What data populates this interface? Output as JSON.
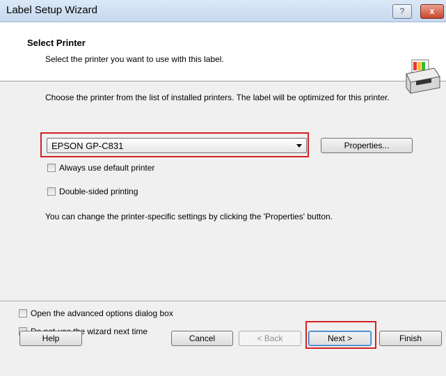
{
  "window": {
    "title": "Label Setup Wizard",
    "help_glyph": "?",
    "close_glyph": "x"
  },
  "header": {
    "title": "Select Printer",
    "subtitle": "Select the printer you want to use with this label."
  },
  "content": {
    "description": "Choose the printer from the list of installed printers. The label will be optimized for this printer.",
    "printer_select": {
      "value": "EPSON GP-C831"
    },
    "properties_button": "Properties...",
    "checkboxes": [
      {
        "label": "Always use default printer",
        "checked": false
      },
      {
        "label": "Double-sided printing",
        "checked": false
      }
    ],
    "info": "You can change the printer-specific settings by clicking the 'Properties' button."
  },
  "footer": {
    "checkboxes": [
      {
        "label": "Open the advanced options dialog box",
        "checked": false
      },
      {
        "label": "Do not use the wizard next time",
        "checked": false
      }
    ],
    "buttons": {
      "help": "Help",
      "cancel": "Cancel",
      "back": "< Back",
      "next": "Next >",
      "finish": "Finish"
    }
  },
  "colors": {
    "highlight": "#d4201f",
    "header_bg": "#ffffff",
    "dialog_bg": "#f0f0f0"
  }
}
